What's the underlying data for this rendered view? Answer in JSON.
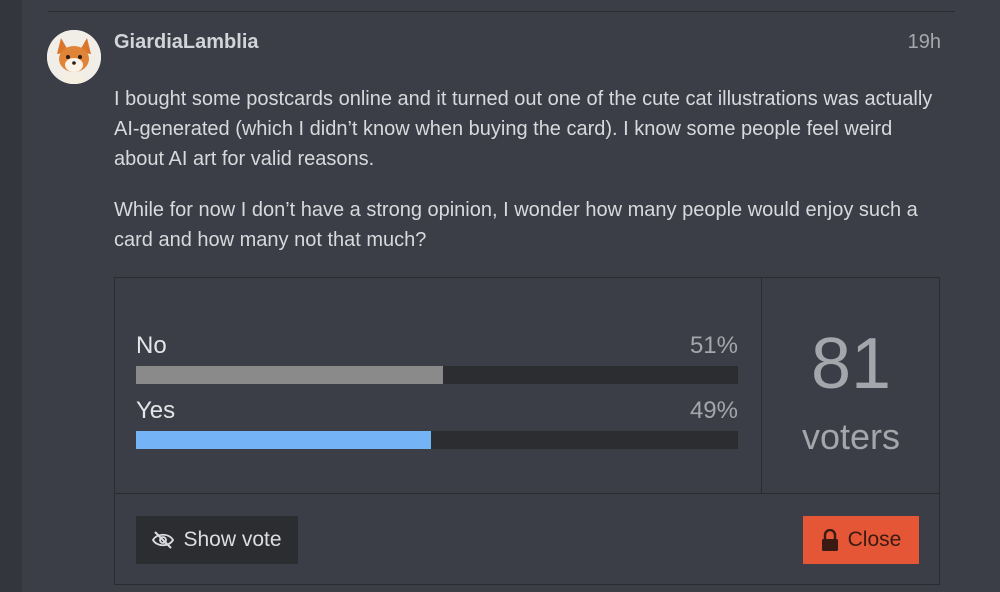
{
  "post": {
    "username": "GiardiaLamblia",
    "timestamp": "19h",
    "paragraphs": [
      "I bought some postcards online and it turned out one of the cute cat illustrations was actually AI-generated (which I didn’t know when buying the card). I know some people feel weird about AI art for valid reasons.",
      "While for now I don’t have a strong opinion, I wonder how many people would enjoy such a card and how many not that much?"
    ]
  },
  "poll": {
    "options": [
      {
        "label": "No",
        "percent_text": "51%",
        "fraction": 0.51,
        "bar_color": "#8a8a8a"
      },
      {
        "label": "Yes",
        "percent_text": "49%",
        "fraction": 0.49,
        "bar_color": "#74b3f5"
      }
    ],
    "voters_count": "81",
    "voters_label": "voters",
    "show_vote_label": "Show vote",
    "close_label": "Close"
  },
  "icons": {
    "avatar": "fox-avatar",
    "show_vote": "eye-slash-icon",
    "close": "lock-icon"
  },
  "colors": {
    "accent_blue": "#74b3f5",
    "close_button": "#e45635"
  }
}
